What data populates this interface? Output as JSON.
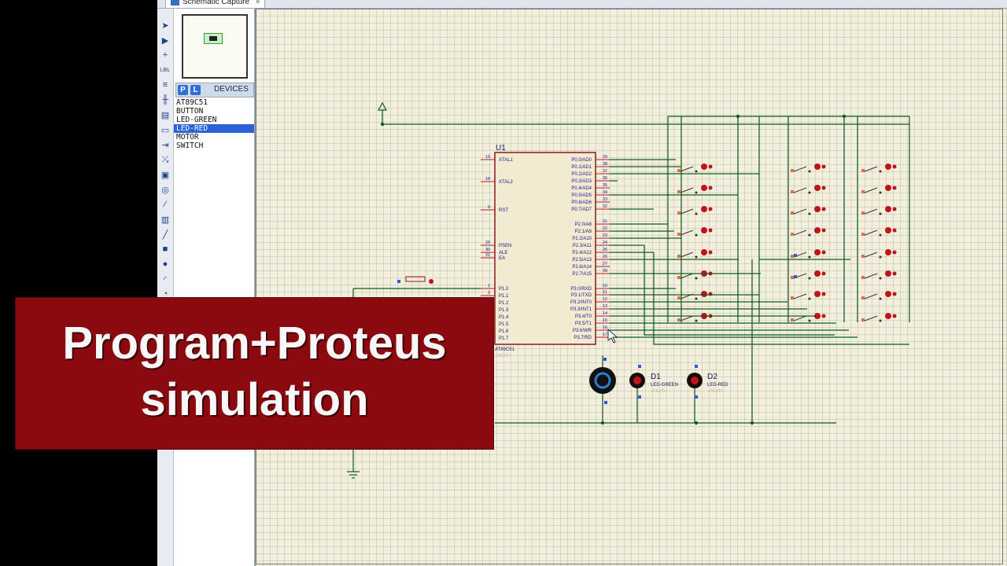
{
  "window": {
    "tab_label": "Schematic Capture",
    "tab_close": "×"
  },
  "toolbar": {
    "tools": [
      "select-arrow-icon",
      "component-icon",
      "junction-icon",
      "wire-label-icon",
      "text-script-icon",
      "bus-icon",
      "subcircuit-icon",
      "terminal-icon",
      "device-pin-icon",
      "graph-icon",
      "tape-recorder-icon",
      "generator-icon",
      "voltage-probe-icon",
      "virtual-instrument-icon",
      "line-icon",
      "box-icon",
      "circle-icon",
      "arc-icon",
      "path-icon"
    ],
    "tool_labels": {
      "wire_label": "LBL"
    }
  },
  "devices_panel": {
    "pick_button": "P",
    "library_button": "L",
    "title": "DEVICES",
    "items": [
      "AT89C51",
      "BUTTON",
      "LED-GREEN",
      "LED-RED",
      "MOTOR",
      "SWITCH"
    ],
    "selected": "LED-RED"
  },
  "schematic": {
    "mcu": {
      "ref": "U1",
      "part": "AT89C51",
      "text_placeholder": "<TEXT>",
      "left_pins": [
        {
          "num": "19",
          "name": "XTAL1"
        },
        {
          "num": "18",
          "name": "XTAL2"
        },
        {
          "num": "9",
          "name": "RST"
        },
        {
          "num": "29",
          "name": "PSEN"
        },
        {
          "num": "30",
          "name": "ALE"
        },
        {
          "num": "31",
          "name": "EA"
        },
        {
          "num": "1",
          "name": "P1.0"
        },
        {
          "num": "2",
          "name": "P1.1"
        },
        {
          "num": "3",
          "name": "P1.2"
        },
        {
          "num": "4",
          "name": "P1.3"
        },
        {
          "num": "5",
          "name": "P1.4"
        },
        {
          "num": "6",
          "name": "P1.5"
        },
        {
          "num": "7",
          "name": "P1.6"
        },
        {
          "num": "8",
          "name": "P1.7"
        }
      ],
      "right_pins": [
        {
          "num": "39",
          "name": "P0.0/AD0"
        },
        {
          "num": "38",
          "name": "P0.1/AD1"
        },
        {
          "num": "37",
          "name": "P0.2/AD2"
        },
        {
          "num": "36",
          "name": "P0.3/AD3"
        },
        {
          "num": "35",
          "name": "P0.4/AD4"
        },
        {
          "num": "34",
          "name": "P0.5/AD5"
        },
        {
          "num": "33",
          "name": "P0.6/AD6"
        },
        {
          "num": "32",
          "name": "P0.7/AD7"
        },
        {
          "num": "21",
          "name": "P2.0/A8"
        },
        {
          "num": "22",
          "name": "P2.1/A9"
        },
        {
          "num": "23",
          "name": "P2.2/A10"
        },
        {
          "num": "24",
          "name": "P2.3/A11"
        },
        {
          "num": "25",
          "name": "P2.4/A12"
        },
        {
          "num": "26",
          "name": "P2.5/A13"
        },
        {
          "num": "27",
          "name": "P2.6/A14"
        },
        {
          "num": "28",
          "name": "P2.7/A15"
        },
        {
          "num": "10",
          "name": "P3.0/RXD"
        },
        {
          "num": "11",
          "name": "P3.1/TXD"
        },
        {
          "num": "12",
          "name": "P3.2/INT0"
        },
        {
          "num": "13",
          "name": "P3.3/INT1"
        },
        {
          "num": "14",
          "name": "P3.4/T0"
        },
        {
          "num": "15",
          "name": "P3.5/T1"
        },
        {
          "num": "16",
          "name": "P3.6/WR"
        },
        {
          "num": "17",
          "name": "P3.7/RD"
        }
      ]
    },
    "d1": {
      "ref": "D1",
      "part": "LED-GREEN",
      "text": "<TEXT>"
    },
    "d2": {
      "ref": "D2",
      "part": "LED-RED",
      "text": "<TEXT>"
    },
    "colors": {
      "wire": "#0b5d1e",
      "body_fill": "#f3ead2",
      "body_stroke": "#8b1a1a",
      "pin_text": "#1a1a8c",
      "ref_text": "#1a1a5a",
      "led_red": "#c0141c",
      "pin_stub": "#c0141c",
      "pin_dot_blue": "#3355dd"
    }
  },
  "banner": {
    "line1": "Program+Proteus",
    "line2": "simulation",
    "bg": "#8b0a10"
  }
}
